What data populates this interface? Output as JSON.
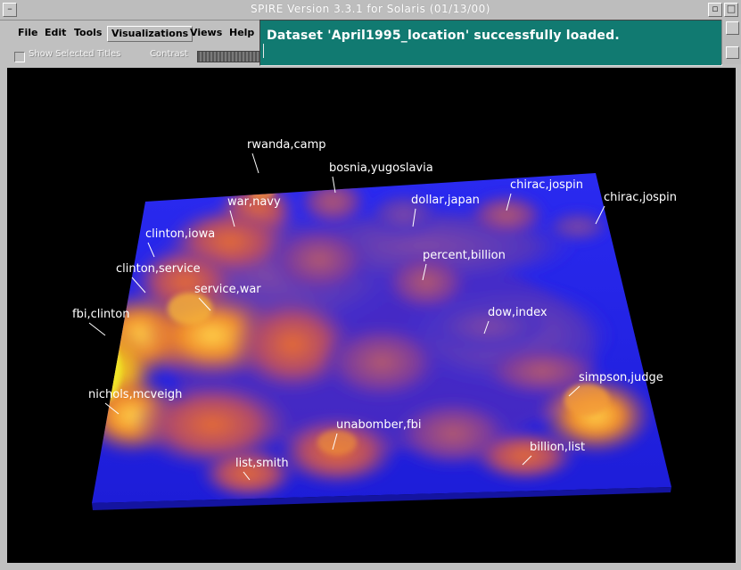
{
  "window": {
    "title": "SPIRE Version 3.3.1 for Solaris  (01/13/00)"
  },
  "menubar": {
    "items": [
      {
        "label": "File"
      },
      {
        "label": "Edit"
      },
      {
        "label": "Tools"
      },
      {
        "label": "Visualizations",
        "active": true
      },
      {
        "label": "Views"
      },
      {
        "label": "Help"
      }
    ]
  },
  "options": {
    "show_selected_titles": "Show Selected Titles",
    "show_selected_checked": false,
    "contrast_label": "Contrast"
  },
  "status": {
    "message": "Dataset 'April1995_location' successfully loaded."
  },
  "colors": {
    "status_bg": "#117a71",
    "terrain_base": "#2222ee",
    "peak_high": "#f0e020"
  },
  "topics": [
    "rwanda,camp",
    "bosnia,yugoslavia",
    "war,navy",
    "dollar,japan",
    "chirac,jospin",
    "chirac,jospin",
    "clinton,iowa",
    "percent,billion",
    "clinton,service",
    "service,war",
    "fbi,clinton",
    "dow,index",
    "simpson,judge",
    "nichols,mcveigh",
    "unabomber,fbi",
    "billion,list",
    "list,smith"
  ]
}
